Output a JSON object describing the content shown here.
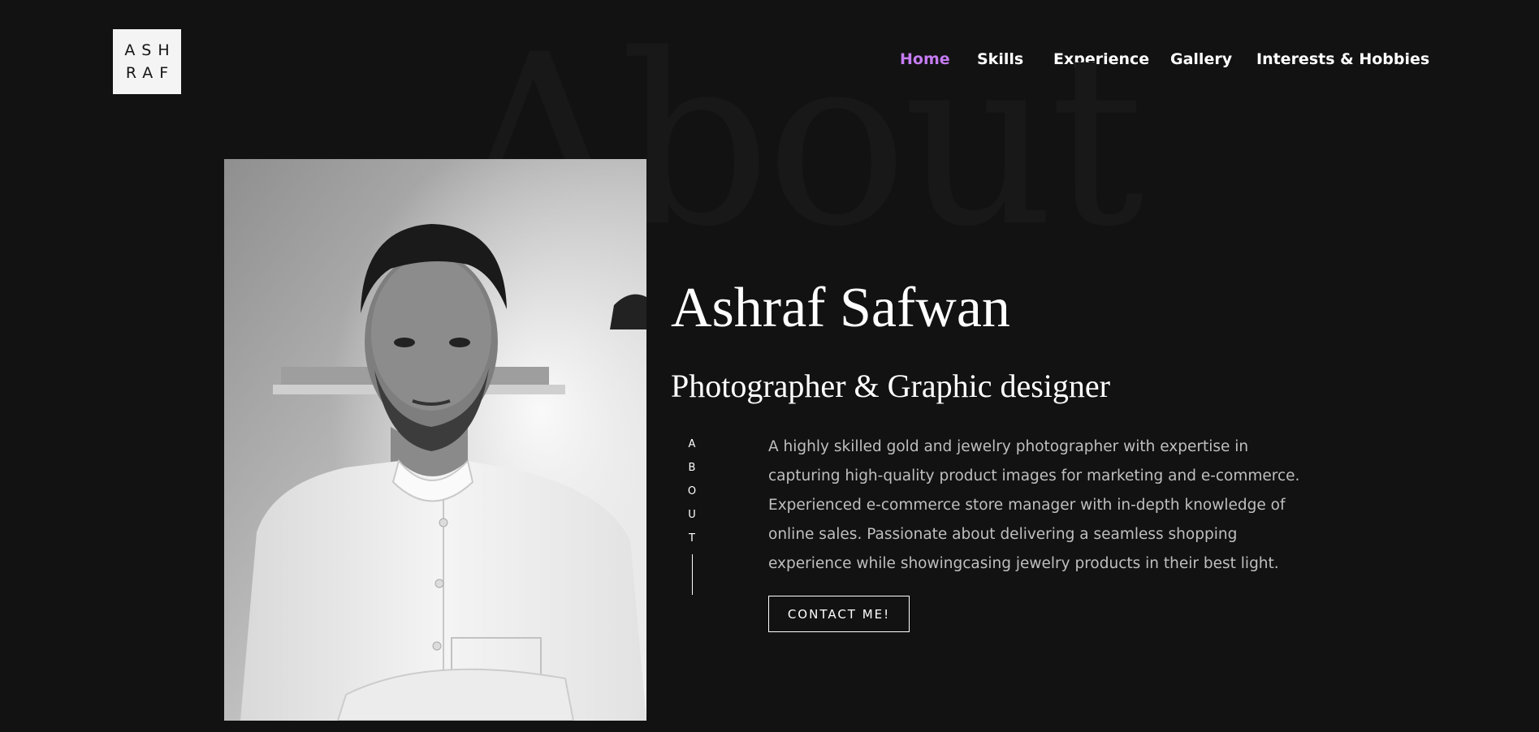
{
  "logo": {
    "line1": "ASH",
    "line2": "RAF"
  },
  "nav": {
    "items": [
      {
        "label": "Home",
        "active": true
      },
      {
        "label": "Skills"
      },
      {
        "label": "Experience"
      },
      {
        "label": "Gallery"
      },
      {
        "label": "Interests & Hobbies"
      }
    ],
    "active_color": "#c57bf2"
  },
  "hero": {
    "background_word": "About",
    "name": "Ashraf Safwan",
    "role": "Photographer & Graphic designer",
    "section_label_letters": [
      "A",
      "B",
      "O",
      "U",
      "T"
    ],
    "description": "A highly skilled gold and jewelry photographer with expertise in capturing high-quality product images for marketing and e-commerce. Experienced e-commerce store manager with in-depth knowledge of online sales. Passionate about delivering a seamless shopping experience while showingcasing jewelry products in their best light.",
    "cta_label": "CONTACT ME!"
  }
}
